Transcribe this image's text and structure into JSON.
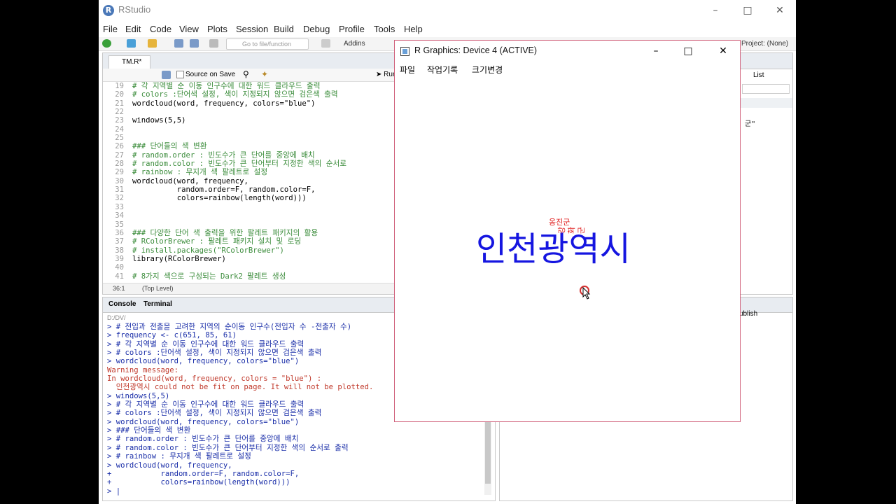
{
  "rstudio": {
    "title": "RStudio",
    "menu": [
      "File",
      "Edit",
      "Code",
      "View",
      "Plots",
      "Session",
      "Build",
      "Debug",
      "Profile",
      "Tools",
      "Help"
    ],
    "toolbar": {
      "goto_placeholder": "Go to file/function",
      "addins": "Addins",
      "project": "Project: (None)"
    },
    "editor": {
      "tab": "TM.R*",
      "source_on_save": "Source on Save",
      "run": "Run",
      "status_pos": "36:1",
      "status_scope": "(Top Level)",
      "lines": [
        {
          "n": "19",
          "t": "# 각 지역별 순 이동 인구수에 대한 워드 클라우드 출력",
          "c": "cm"
        },
        {
          "n": "20",
          "t": "# colors :단어색 설정, 색이 지정되지 않으면 검은색 출력",
          "c": "cm"
        },
        {
          "n": "21",
          "t": "wordcloud(word, frequency, colors=\"blue\")",
          "c": ""
        },
        {
          "n": "22",
          "t": "",
          "c": ""
        },
        {
          "n": "23",
          "t": "windows(5,5)",
          "c": ""
        },
        {
          "n": "24",
          "t": "",
          "c": ""
        },
        {
          "n": "25",
          "t": "",
          "c": ""
        },
        {
          "n": "26",
          "t": "### 단어들의 색 변환",
          "c": "cm"
        },
        {
          "n": "27",
          "t": "# random.order : 빈도수가 큰 단어를 중앙에 배치",
          "c": "cm"
        },
        {
          "n": "28",
          "t": "# random.color : 빈도수가 큰 단어부터 지정한 색의 순서로",
          "c": "cm"
        },
        {
          "n": "29",
          "t": "# rainbow : 무지개 색 팔레트로 설정",
          "c": "cm"
        },
        {
          "n": "30",
          "t": "wordcloud(word, frequency,",
          "c": ""
        },
        {
          "n": "31",
          "t": "          random.order=F, random.color=F,",
          "c": ""
        },
        {
          "n": "32",
          "t": "          colors=rainbow(length(word)))",
          "c": ""
        },
        {
          "n": "33",
          "t": "",
          "c": ""
        },
        {
          "n": "34",
          "t": "",
          "c": ""
        },
        {
          "n": "35",
          "t": "",
          "c": ""
        },
        {
          "n": "36",
          "t": "### 다양한 단어 색 출력을 위한 팔레트 패키지의 활용",
          "c": "cm"
        },
        {
          "n": "37",
          "t": "# RColorBrewer : 팔레트 패키지 설치 및 로딩",
          "c": "cm"
        },
        {
          "n": "38",
          "t": "# install.packages(\"RColorBrewer\")",
          "c": "cm"
        },
        {
          "n": "39",
          "t": "library(RColorBrewer)",
          "c": ""
        },
        {
          "n": "40",
          "t": "",
          "c": ""
        },
        {
          "n": "41",
          "t": "# 8가지 색으로 구성되는 Dark2 팔레트 생성",
          "c": "cm"
        }
      ]
    },
    "console": {
      "tab_console": "Console",
      "tab_terminal": "Terminal",
      "path": "D:/DV/",
      "lines": [
        {
          "t": "> # 전입과 전출을 고려한 지역의 순이동 인구수(전입자 수 -전출자 수)",
          "c": ""
        },
        {
          "t": "> frequency <- c(651, 85, 61)",
          "c": ""
        },
        {
          "t": "> # 각 지역별 순 이동 인구수에 대한 워드 클라우드 출력",
          "c": ""
        },
        {
          "t": "> # colors :단어색 설정, 색이 지정되지 않으면 검은색 출력",
          "c": ""
        },
        {
          "t": "> wordcloud(word, frequency, colors=\"blue\")",
          "c": ""
        },
        {
          "t": "Warning message:",
          "c": "err"
        },
        {
          "t": "In wordcloud(word, frequency, colors = \"blue\") :",
          "c": "err"
        },
        {
          "t": "  인천광역시 could not be fit on page. It will not be plotted.",
          "c": "err"
        },
        {
          "t": "> windows(5,5)",
          "c": ""
        },
        {
          "t": "> # 각 지역별 순 이동 인구수에 대한 워드 클라우드 출력",
          "c": ""
        },
        {
          "t": "> # colors :단어색 설정, 색이 지정되지 않으면 검은색 출력",
          "c": ""
        },
        {
          "t": "> wordcloud(word, frequency, colors=\"blue\")",
          "c": ""
        },
        {
          "t": "> ### 단어들의 색 변환",
          "c": ""
        },
        {
          "t": "> # random.order : 빈도수가 큰 단어를 중앙에 배치",
          "c": ""
        },
        {
          "t": "> # random.color : 빈도수가 큰 단어부터 지정한 색의 순서로 출력",
          "c": ""
        },
        {
          "t": "> # rainbow : 무지개 색 팔레트로 설정",
          "c": ""
        },
        {
          "t": "> wordcloud(word, frequency,",
          "c": ""
        },
        {
          "t": "+           random.order=F, random.color=F,",
          "c": ""
        },
        {
          "t": "+           colors=rainbow(length(word)))",
          "c": ""
        },
        {
          "t": "> |",
          "c": ""
        }
      ]
    },
    "env_pane": {
      "list_label": "List",
      "value_fragment": "군\""
    },
    "files_pane": {
      "publish": "ublish"
    }
  },
  "graphics_window": {
    "title": "R Graphics: Device 4 (ACTIVE)",
    "menu": [
      "파일",
      "작업기록",
      "크기변경"
    ],
    "words": [
      {
        "text": "인천광역시",
        "color": "#1515e0"
      },
      {
        "text": "옹진군",
        "color": "#e02020"
      },
      {
        "text": "강화군",
        "color": "#e02020"
      }
    ]
  }
}
